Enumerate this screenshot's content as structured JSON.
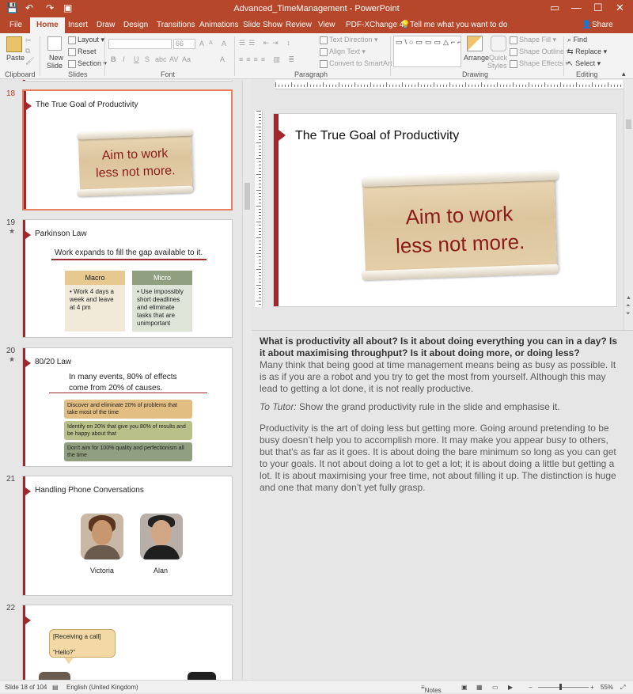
{
  "titlebar": {
    "title": "Advanced_TimeManagement  -  PowerPoint",
    "quick_access": {
      "save": "💾",
      "undo": "↶",
      "redo": "↷",
      "present": "▣"
    },
    "window_controls": {
      "ribbon_options": "▭",
      "minimize": "—",
      "maximize": "☐",
      "close": "✕"
    }
  },
  "tabs": [
    "File",
    "Home",
    "Insert",
    "Draw",
    "Design",
    "Transitions",
    "Animations",
    "Slide Show",
    "Review",
    "View",
    "PDF-XChange 4"
  ],
  "active_tab": "Home",
  "tell_me": "Tell me what you want to do",
  "share": "Share",
  "ribbon": {
    "clipboard": {
      "label": "Clipboard",
      "paste": "Paste"
    },
    "slides": {
      "label": "Slides",
      "new_slide": "New",
      "new_slide2": "Slide",
      "layout": "Layout",
      "reset": "Reset",
      "section": "Section"
    },
    "font": {
      "label": "Font",
      "size": "66",
      "bold": "B",
      "italic": "I",
      "underline": "U",
      "strike": "S",
      "shadow": "abc",
      "spacing": "AV",
      "case": "Aa",
      "grow": "A",
      "shrink": "A",
      "clear": "A",
      "color": "A"
    },
    "paragraph": {
      "label": "Paragraph",
      "text_direction": "Text Direction",
      "align_text": "Align Text",
      "smartart": "Convert to SmartArt"
    },
    "drawing": {
      "label": "Drawing",
      "shapes": "▭\\○▭▭▭△⌐⌐⇨⇩☆{}",
      "arrange": "Arrange",
      "quick_styles": "Quick",
      "quick_styles2": "Styles",
      "shape_fill": "Shape Fill",
      "shape_outline": "Shape Outline",
      "shape_effects": "Shape Effects"
    },
    "editing": {
      "label": "Editing",
      "find": "Find",
      "replace": "Replace",
      "select": "Select"
    }
  },
  "thumbnails": {
    "slide18": {
      "num": "18",
      "title": "The True Goal of Productivity",
      "scroll_line1": "Aim to work",
      "scroll_line2": "less not more."
    },
    "slide19": {
      "num": "19",
      "star": "★",
      "title": "Parkinson Law",
      "headline": "Work expands to fill the gap available to it.",
      "col1_title": "Macro",
      "col1_text": "• Work 4 days a week and leave at 4 pm",
      "col2_title": "Micro",
      "col2_text": "• Use impossibly short deadlines and eliminate tasks that are unimportant"
    },
    "slide20": {
      "num": "20",
      "star": "★",
      "title": "80/20 Law",
      "headline1": "In many events, 80% of effects",
      "headline2": "come from 20% of causes.",
      "box1": "Discover and eliminate 20% of problems that take most of the time",
      "box2": "Identify on 20% that give you 80% of results and be happy about that",
      "box3": "Don't aim for 100% quality and perfectionism all the time"
    },
    "slide21": {
      "num": "21",
      "title": "Handling Phone Conversations",
      "person1": "Victoria",
      "person2": "Alan"
    },
    "slide22": {
      "num": "22",
      "bubble1": "[Receiving a call]",
      "bubble2": "“Hello?”"
    }
  },
  "main_slide": {
    "title": "The True Goal of Productivity",
    "scroll_line1": "Aim to work",
    "scroll_line2": "less not more."
  },
  "notes": {
    "p1_bold": "What is productivity all about? Is it about doing everything you can in a day? Is it about maximising throughput? Is it about doing more, or doing less?",
    "p1_rest": "Many think that being good at time management means being as busy as possible. It is as if you are a robot and you try to get the most from yourself. Although this may lead to getting a lot done, it is not really productive.",
    "p2_label": "To Tutor:",
    "p2_rest": " Show the grand productivity rule in the slide and emphasise it.",
    "p3": "Productivity is the art of doing less but getting more. Going around pretending to be busy doesn’t help you to accomplish more. It may make you appear busy to others, but that’s as far as it goes. It is about doing the bare minimum so long as you can get to your goals. It not about doing a lot to get a lot; it is about doing a little but getting a lot. It is about maximising your free time, not about filling it up. The distinction is huge and one that many don’t yet fully grasp."
  },
  "statusbar": {
    "slide_of": "Slide 18 of 104",
    "language": "English (United Kingdom)",
    "notes": "Notes",
    "zoom": "55%"
  },
  "colors": {
    "accent": "#b7472a",
    "slide_bar": "#a0282d",
    "scroll_text": "#8b1a1a"
  }
}
